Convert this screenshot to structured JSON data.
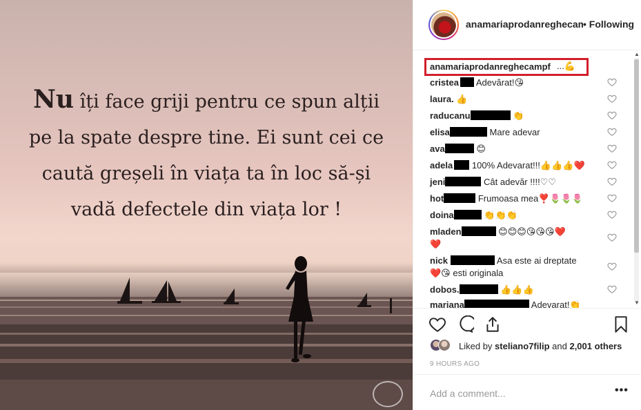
{
  "image": {
    "quote_big_word": "Nu",
    "quote_line1": "îți face griji pentru ce spun alții",
    "quote_line2": "pe la spate despre tine. Ei sunt cei ce",
    "quote_line3": "caută greșeli în viața ta în loc să-și",
    "quote_line4": "vadă defectele din viața lor !"
  },
  "header": {
    "username": "anamariaprodanreghecampf",
    "follow_status": "• Following"
  },
  "caption": {
    "username": "anamariaprodanreghecampf",
    "more": "...💪"
  },
  "comments": [
    {
      "user": "cristea",
      "redact_w": 20,
      "text": "Adevărat!😘"
    },
    {
      "user": "laura.",
      "redact_w": 0,
      "text": "👍"
    },
    {
      "user": "raducanu",
      "redact_w": 58,
      "text": "👏"
    },
    {
      "user": "elisa",
      "redact_w": 54,
      "text": "Mare adevar"
    },
    {
      "user": "ava",
      "redact_w": 42,
      "text": "😊"
    },
    {
      "user": "adela",
      "redact_w": 22,
      "text": "100% Adevarat!!!👍👍👍❤️"
    },
    {
      "user": "jeni",
      "redact_w": 52,
      "text": "Cât adevăr !!!!♡♡"
    },
    {
      "user": "hot",
      "redact_w": 46,
      "text": "Frumoasa mea❣️🌷🌷🌷"
    },
    {
      "user": "doina",
      "redact_w": 40,
      "text": "👏👏👏"
    },
    {
      "user": "mladen",
      "redact_w": 50,
      "text": "😊😊😊😘😘😘❤️",
      "text2": "❤️"
    },
    {
      "user": "nick",
      "redact_w": 64,
      "text": "Asa este ai dreptate",
      "text2": "❤️😘 esti originala"
    },
    {
      "user": "dobos.",
      "redact_w": 56,
      "text": "👍👍👍"
    },
    {
      "user": "mariana",
      "redact_w": 94,
      "text": "Adevarat!👏"
    }
  ],
  "likes": {
    "prefix": "Liked by",
    "user": "steliano7filip",
    "mid": "and",
    "count": "2,001 others"
  },
  "timestamp": "9 HOURS AGO",
  "add_comment": {
    "placeholder": "Add a comment...",
    "more": "•••"
  },
  "colors": {
    "highlight_border": "#d21f2b",
    "text": "#262626",
    "muted": "#999999"
  },
  "icons": [
    "heart-icon",
    "comment-icon",
    "share-icon",
    "bookmark-icon",
    "small-heart-icon",
    "options-icon"
  ]
}
